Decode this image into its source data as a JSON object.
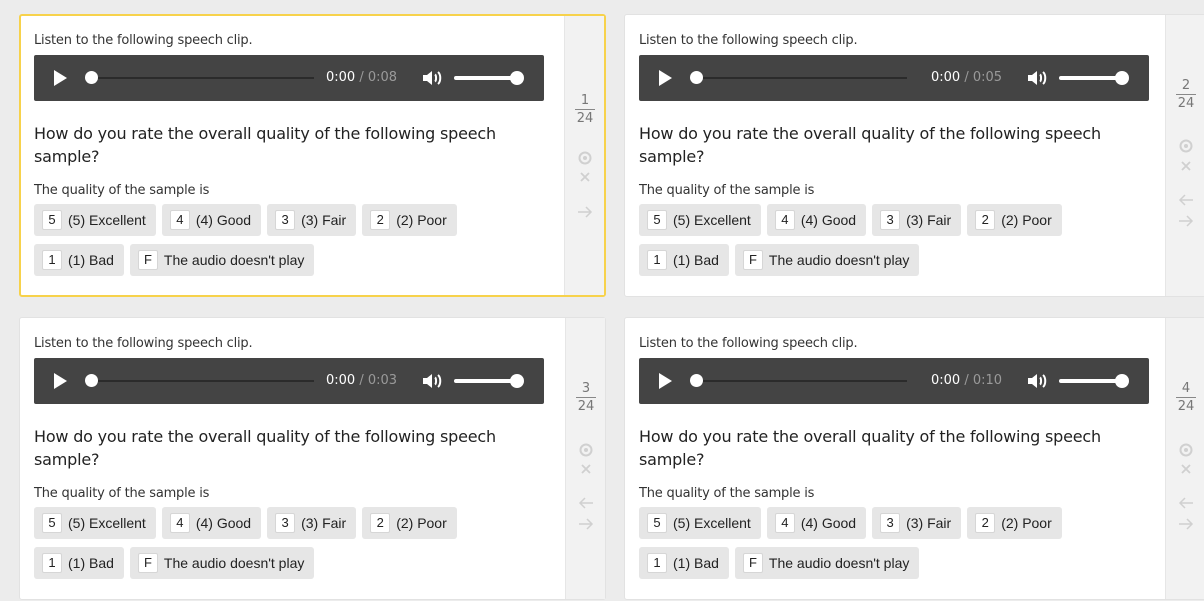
{
  "tasks": [
    {
      "listen_label": "Listen to the following speech clip.",
      "current_time": "0:00",
      "separator": "/",
      "duration": "0:08",
      "question": "How do you rate the overall quality of the following speech sample?",
      "quality_label": "The quality of the sample is",
      "options": [
        {
          "key": "5",
          "label": "(5) Excellent"
        },
        {
          "key": "4",
          "label": "(4) Good"
        },
        {
          "key": "3",
          "label": "(3) Fair"
        },
        {
          "key": "2",
          "label": "(2) Poor"
        },
        {
          "key": "1",
          "label": "(1) Bad"
        },
        {
          "key": "F",
          "label": "The audio doesn't play"
        }
      ],
      "counter": {
        "num": "1",
        "den": "24"
      },
      "active": true,
      "has_back_arrow": false
    },
    {
      "listen_label": "Listen to the following speech clip.",
      "current_time": "0:00",
      "separator": "/",
      "duration": "0:05",
      "question": "How do you rate the overall quality of the following speech sample?",
      "quality_label": "The quality of the sample is",
      "options": [
        {
          "key": "5",
          "label": "(5) Excellent"
        },
        {
          "key": "4",
          "label": "(4) Good"
        },
        {
          "key": "3",
          "label": "(3) Fair"
        },
        {
          "key": "2",
          "label": "(2) Poor"
        },
        {
          "key": "1",
          "label": "(1) Bad"
        },
        {
          "key": "F",
          "label": "The audio doesn't play"
        }
      ],
      "counter": {
        "num": "2",
        "den": "24"
      },
      "active": false,
      "has_back_arrow": true
    },
    {
      "listen_label": "Listen to the following speech clip.",
      "current_time": "0:00",
      "separator": "/",
      "duration": "0:03",
      "question": "How do you rate the overall quality of the following speech sample?",
      "quality_label": "The quality of the sample is",
      "options": [
        {
          "key": "5",
          "label": "(5) Excellent"
        },
        {
          "key": "4",
          "label": "(4) Good"
        },
        {
          "key": "3",
          "label": "(3) Fair"
        },
        {
          "key": "2",
          "label": "(2) Poor"
        },
        {
          "key": "1",
          "label": "(1) Bad"
        },
        {
          "key": "F",
          "label": "The audio doesn't play"
        }
      ],
      "counter": {
        "num": "3",
        "den": "24"
      },
      "active": false,
      "has_back_arrow": true
    },
    {
      "listen_label": "Listen to the following speech clip.",
      "current_time": "0:00",
      "separator": "/",
      "duration": "0:10",
      "question": "How do you rate the overall quality of the following speech sample?",
      "quality_label": "The quality of the sample is",
      "options": [
        {
          "key": "5",
          "label": "(5) Excellent"
        },
        {
          "key": "4",
          "label": "(4) Good"
        },
        {
          "key": "3",
          "label": "(3) Fair"
        },
        {
          "key": "2",
          "label": "(2) Poor"
        },
        {
          "key": "1",
          "label": "(1) Bad"
        },
        {
          "key": "F",
          "label": "The audio doesn't play"
        }
      ],
      "counter": {
        "num": "4",
        "den": "24"
      },
      "active": false,
      "has_back_arrow": true
    }
  ],
  "colors": {
    "active_border": "#f7d24b",
    "player_bg": "#444444",
    "option_bg": "#e6e6e6",
    "side_icon": "#d0d0d0"
  },
  "icons": [
    "play-icon",
    "volume-icon",
    "eye-icon",
    "close-icon",
    "arrow-left-icon",
    "arrow-right-icon"
  ]
}
